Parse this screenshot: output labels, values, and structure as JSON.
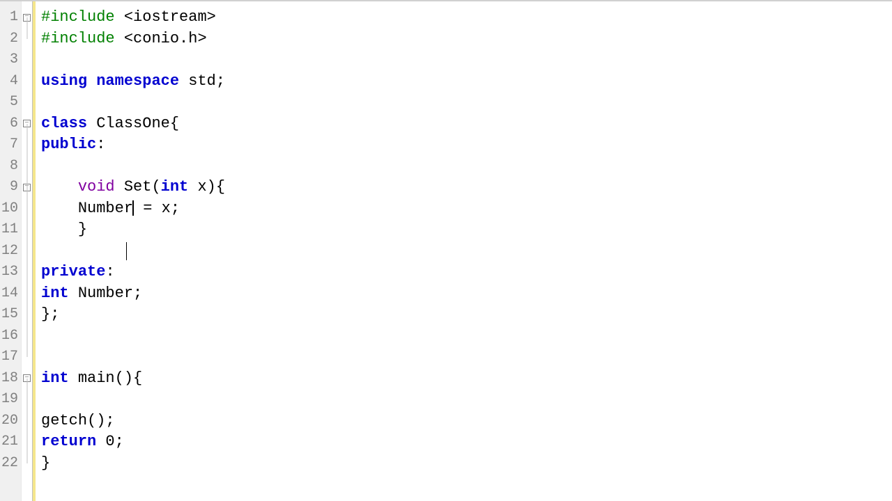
{
  "lines": {
    "1": {
      "n": "1"
    },
    "2": {
      "n": "2"
    },
    "3": {
      "n": "3"
    },
    "4": {
      "n": "4"
    },
    "5": {
      "n": "5"
    },
    "6": {
      "n": "6"
    },
    "7": {
      "n": "7"
    },
    "8": {
      "n": "8"
    },
    "9": {
      "n": "9"
    },
    "10": {
      "n": "10"
    },
    "11": {
      "n": "11"
    },
    "12": {
      "n": "12"
    },
    "13": {
      "n": "13"
    },
    "14": {
      "n": "14"
    },
    "15": {
      "n": "15"
    },
    "16": {
      "n": "16"
    },
    "17": {
      "n": "17"
    },
    "18": {
      "n": "18"
    },
    "19": {
      "n": "19"
    },
    "20": {
      "n": "20"
    },
    "21": {
      "n": "21"
    },
    "22": {
      "n": "22"
    }
  },
  "code": {
    "include_kw": "#include",
    "iostream": " <iostream>",
    "conioh": " <conio.h>",
    "using": "using",
    "namespace": "namespace",
    "std_semi": " std;",
    "class": "class",
    "classone_brace": " ClassOne{",
    "public": "public",
    "colon": ":",
    "void": "void",
    "set_open": " Set(",
    "int": "int",
    "x_close_brace": " x){",
    "number_eq_x": "    Number",
    "eq_x_semi": " = x;",
    "close_brace": "    }",
    "private": "private",
    "number_semi": " Number;",
    "close_brace_semi": "};",
    "main_open": " main(){",
    "getch": "getch();",
    "return": "return",
    "zero_semi": " 0;",
    "close_brace2": "}",
    "space_ns": " ",
    "indent4": "    "
  },
  "fold_glyph": "−"
}
